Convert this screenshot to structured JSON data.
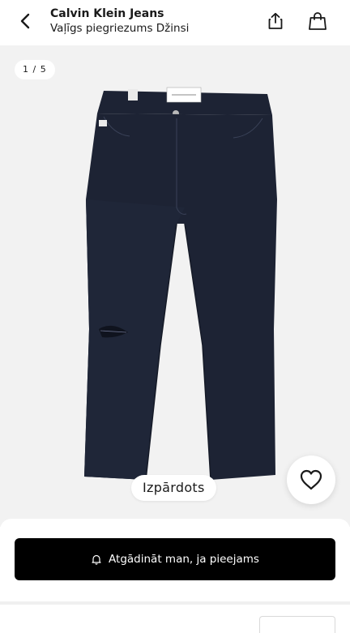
{
  "header": {
    "brand": "Calvin Klein Jeans",
    "product_name": "Vaļīgs piegriezums Džinsi",
    "icons": {
      "back": "chevron-left-icon",
      "share": "share-icon",
      "bag": "shopping-bag-icon"
    }
  },
  "gallery": {
    "counter": "1 / 5",
    "sale_badge": "Izpārdots",
    "image": {
      "subject": "dark-denim-jeans",
      "color": "#1d2334"
    },
    "wishlist_icon": "heart-outline-icon"
  },
  "action": {
    "notify_label": "Atgādināt man, ja pieejams",
    "notify_icon": "bell-icon"
  },
  "colors": {
    "background": "#ffffff",
    "gallery_bg": "#f2f2f2",
    "primary_button": "#000000",
    "primary_button_text": "#ffffff",
    "denim": "#1d2334"
  }
}
